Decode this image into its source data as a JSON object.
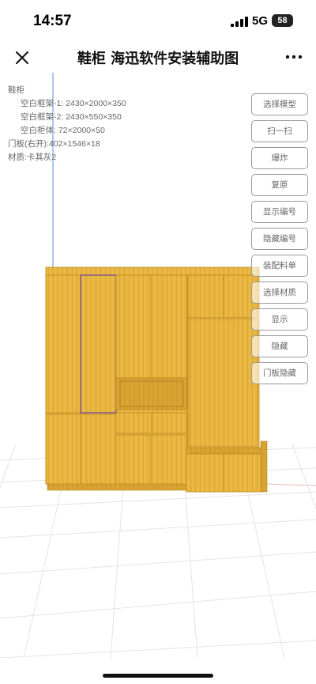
{
  "status": {
    "time": "14:57",
    "network": "5G",
    "battery": "58"
  },
  "nav": {
    "title": "鞋柜 海迅软件安装辅助图",
    "close_icon": "close-icon",
    "more_icon": "more-dots-icon"
  },
  "info": {
    "name": "鞋柜",
    "parts": [
      "空白框架-1: 2430×2000×350",
      "空白框架-2: 2430×550×350",
      "空白柜体: 72×2000×50"
    ],
    "door": "门板(右开):402×1546×18",
    "material": "材质:卡其灰2"
  },
  "buttons": [
    "选择模型",
    "扫一扫",
    "爆炸",
    "复原",
    "显示编号",
    "隐藏编号",
    "装配料单",
    "选择材质",
    "显示",
    "隐藏",
    "门板隐藏"
  ],
  "colors": {
    "wood": "#e9b53e",
    "wood_edge": "#b98a22",
    "selected_outline": "#7d4f9a",
    "guide_line": "#5b8ed6",
    "grid": "#e4e4e4"
  }
}
